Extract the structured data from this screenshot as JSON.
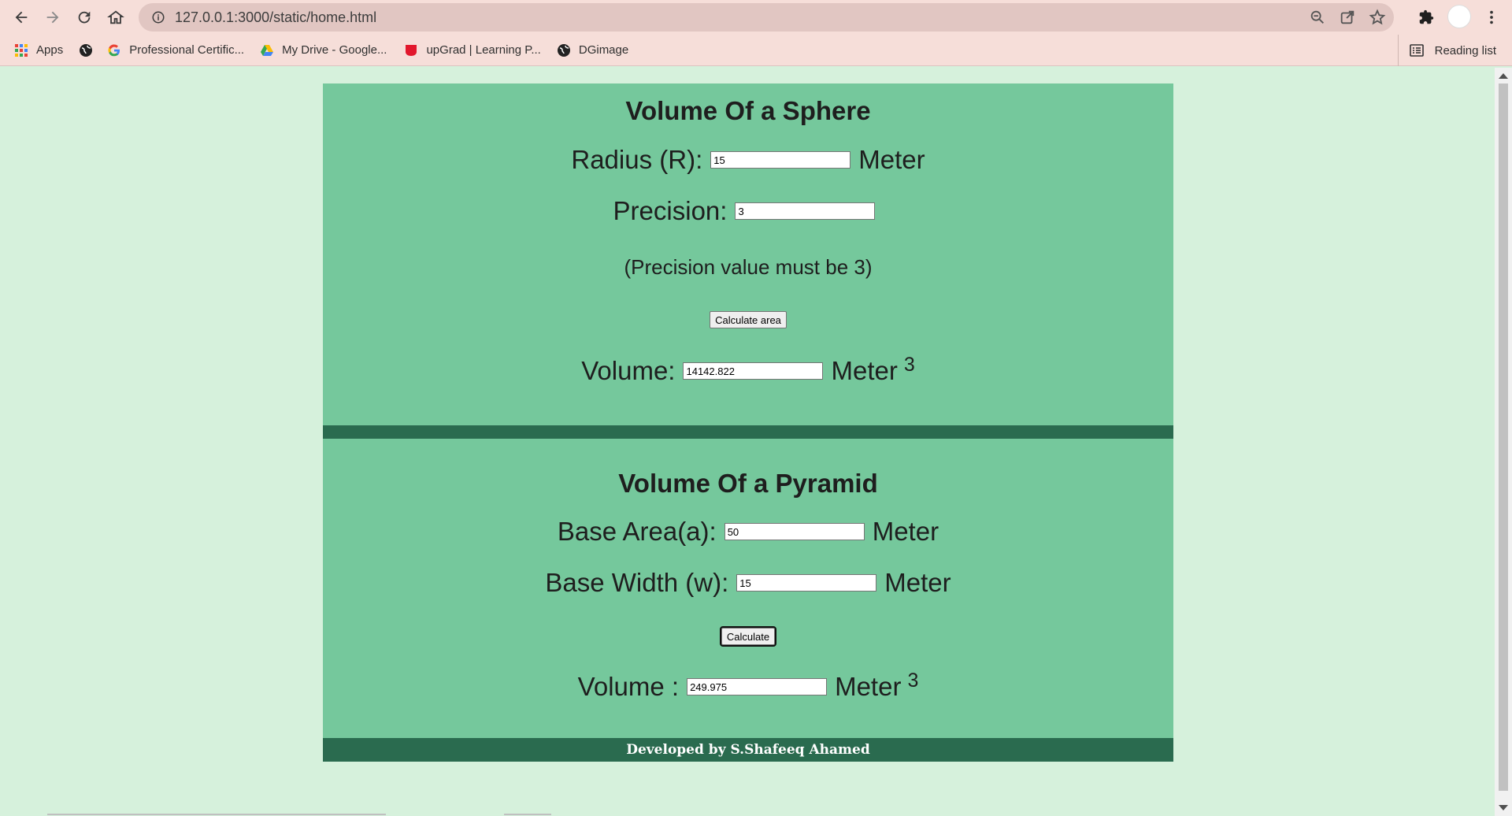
{
  "browser": {
    "url": "127.0.0.1:3000/static/home.html",
    "bookmarks": [
      {
        "label": "Apps",
        "icon": "apps-grid-icon"
      },
      {
        "label": "",
        "icon": "globe-icon"
      },
      {
        "label": "Professional Certific...",
        "icon": "google-icon"
      },
      {
        "label": "My Drive - Google...",
        "icon": "drive-icon"
      },
      {
        "label": "upGrad | Learning P...",
        "icon": "upgrad-icon"
      },
      {
        "label": "DGimage",
        "icon": "globe-icon"
      }
    ],
    "reading_list": "Reading list"
  },
  "sphere": {
    "title": "Volume Of a Sphere",
    "radius_label": "Radius (R):",
    "radius_value": "15",
    "radius_unit": "Meter",
    "precision_label": "Precision:",
    "precision_value": "3",
    "note": "(Precision value must be 3)",
    "button": "Calculate area",
    "volume_label": "Volume:",
    "volume_value": "14142.822",
    "volume_unit": "Meter",
    "volume_exp": "3"
  },
  "pyramid": {
    "title": "Volume Of a Pyramid",
    "base_area_label": "Base Area(a):",
    "base_area_value": "50",
    "base_area_unit": "Meter",
    "base_width_label": "Base Width (w):",
    "base_width_value": "15",
    "base_width_unit": "Meter",
    "button": "Calculate",
    "volume_label": "Volume :",
    "volume_value": "249.975",
    "volume_unit": "Meter",
    "volume_exp": "3"
  },
  "footer": {
    "text": "Developed by S.Shafeeq Ahamed"
  }
}
